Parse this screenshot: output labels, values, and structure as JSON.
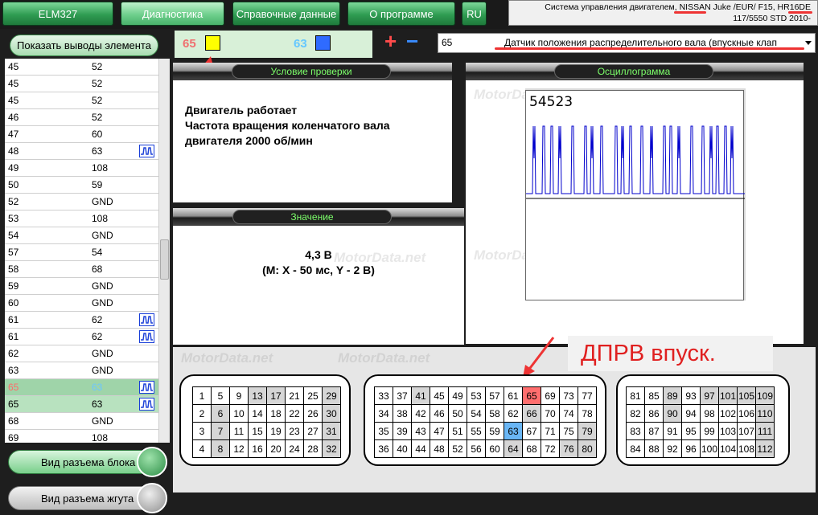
{
  "nav": {
    "elm": "ELM327",
    "diag": "Диагностика",
    "ref": "Справочные данные",
    "about": "О программе",
    "lang": "RU"
  },
  "vehicle": {
    "line1": "Система управления двигателем, NISSAN  Juke /EUR/  F15,   HR16DE",
    "line2": "117/5550  STD  2010-"
  },
  "left": {
    "show_pins": "Показать выводы элемента",
    "block_view": "Вид разъема блока",
    "harness_view": "Вид разъема жгута"
  },
  "pins": [
    {
      "a": "45",
      "b": "52",
      "wave": false
    },
    {
      "a": "45",
      "b": "52",
      "wave": false
    },
    {
      "a": "45",
      "b": "52",
      "wave": false
    },
    {
      "a": "46",
      "b": "52",
      "wave": false
    },
    {
      "a": "47",
      "b": "60",
      "wave": false
    },
    {
      "a": "48",
      "b": "63",
      "wave": true
    },
    {
      "a": "49",
      "b": "108",
      "wave": false
    },
    {
      "a": "50",
      "b": "59",
      "wave": false
    },
    {
      "a": "52",
      "b": "GND",
      "wave": false
    },
    {
      "a": "53",
      "b": "108",
      "wave": false
    },
    {
      "a": "54",
      "b": "GND",
      "wave": false
    },
    {
      "a": "57",
      "b": "54",
      "wave": false
    },
    {
      "a": "58",
      "b": "68",
      "wave": false
    },
    {
      "a": "59",
      "b": "GND",
      "wave": false
    },
    {
      "a": "60",
      "b": "GND",
      "wave": false
    },
    {
      "a": "61",
      "b": "62",
      "wave": true
    },
    {
      "a": "61",
      "b": "62",
      "wave": true
    },
    {
      "a": "62",
      "b": "GND",
      "wave": false
    },
    {
      "a": "63",
      "b": "GND",
      "wave": false
    },
    {
      "a": "65",
      "b": "63",
      "wave": true
    },
    {
      "a": "65",
      "b": "63",
      "wave": true
    },
    {
      "a": "68",
      "b": "GND",
      "wave": false
    },
    {
      "a": "69",
      "b": "108",
      "wave": false
    }
  ],
  "legend": {
    "pin_a": "65",
    "color_a": "#ffff00",
    "pin_b": "63",
    "color_b": "#2f6bff",
    "plus": "+",
    "minus": "−"
  },
  "sensor": {
    "code": "65",
    "name": "Датчик положения распределительного вала (впускные клап"
  },
  "panels": {
    "condition_title": "Условие проверки",
    "condition_text": "Двигатель работает\nЧастота вращения коленчатого вала\nдвигателя 2000 об/мин",
    "value_title": "Значение",
    "value_main": "4,3 В",
    "value_scale": "(M: X - 50 мс, Y - 2 В)",
    "scope_title": "Осциллограмма",
    "scope_number": "54523",
    "watermark": "MotorData.net"
  },
  "callout": "ДПРВ впуск.",
  "connector1": [
    [
      "1",
      "5",
      "9",
      "13",
      "17",
      "21",
      "25",
      "29"
    ],
    [
      "2",
      "6",
      "10",
      "14",
      "18",
      "22",
      "26",
      "30"
    ],
    [
      "3",
      "7",
      "11",
      "15",
      "19",
      "23",
      "27",
      "31"
    ],
    [
      "4",
      "8",
      "12",
      "16",
      "20",
      "24",
      "28",
      "32"
    ]
  ],
  "connector2": [
    [
      "33",
      "37",
      "41",
      "45",
      "49",
      "53",
      "57",
      "61",
      "65",
      "69",
      "73",
      "77"
    ],
    [
      "34",
      "38",
      "42",
      "46",
      "50",
      "54",
      "58",
      "62",
      "66",
      "70",
      "74",
      "78"
    ],
    [
      "35",
      "39",
      "43",
      "47",
      "51",
      "55",
      "59",
      "63",
      "67",
      "71",
      "75",
      "79"
    ],
    [
      "36",
      "40",
      "44",
      "48",
      "52",
      "56",
      "60",
      "64",
      "68",
      "72",
      "76",
      "80"
    ]
  ],
  "connector3": [
    [
      "81",
      "85",
      "89",
      "93",
      "97",
      "101",
      "105",
      "109"
    ],
    [
      "82",
      "86",
      "90",
      "94",
      "98",
      "102",
      "106",
      "110"
    ],
    [
      "83",
      "87",
      "91",
      "95",
      "99",
      "103",
      "107",
      "111"
    ],
    [
      "84",
      "88",
      "92",
      "96",
      "100",
      "104",
      "108",
      "112"
    ]
  ],
  "colors": {
    "accent_red": "#e02020",
    "highlight_red": "#ff6e6e",
    "highlight_blue": "#69b6f5",
    "trace": "#0000cc"
  }
}
